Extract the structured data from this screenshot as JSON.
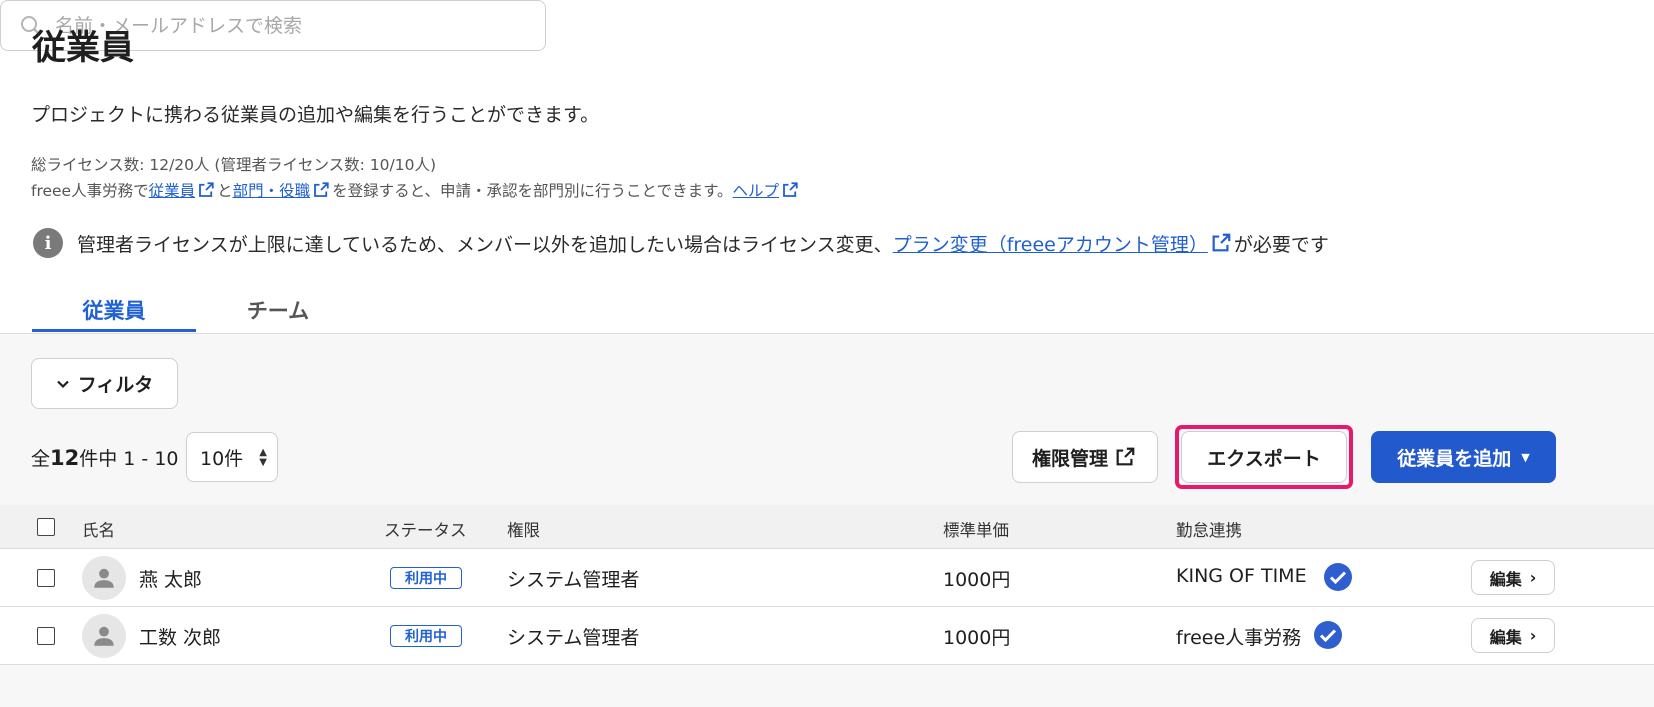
{
  "page": {
    "title": "従業員",
    "description": "プロジェクトに携わる従業員の追加や編集を行うことができます。",
    "license_info": "総ライセンス数: 12/20人 (管理者ライセンス数: 10/10人)",
    "register_prefix": "freee人事労務で",
    "register_link_employee": "従業員",
    "register_and": "と",
    "register_link_dept": "部門・役職",
    "register_suffix": "を登録すると、申請・承認を部門別に行うことできます。",
    "help_link": "ヘルプ"
  },
  "notice": {
    "text": "管理者ライセンスが上限に達しているため、メンバー以外を追加したい場合はライセンス変更、",
    "link": "プラン変更（freeeアカウント管理）",
    "suffix": "が必要です"
  },
  "tabs": [
    {
      "label": "従業員",
      "active": true
    },
    {
      "label": "チーム",
      "active": false
    }
  ],
  "toolbar": {
    "filter_label": "フィルタ",
    "search_placeholder": "名前・メールアドレスで検索",
    "count_prefix": "全",
    "count_total": "12",
    "count_suffix": "件中 1 - 10",
    "per_page": "10件",
    "permission_label": "権限管理",
    "export_label": "エクスポート",
    "add_label": "従業員を追加"
  },
  "table": {
    "headers": {
      "name": "氏名",
      "status": "ステータス",
      "role": "権限",
      "rate": "標準単価",
      "attendance": "勤怠連携"
    },
    "rows": [
      {
        "name": "燕 太郎",
        "status": "利用中",
        "role": "システム管理者",
        "rate": "1000円",
        "attendance": "KING OF TIME",
        "edit": "編集"
      },
      {
        "name": "工数 次郎",
        "status": "利用中",
        "role": "システム管理者",
        "rate": "1000円",
        "attendance": "freee人事労務",
        "edit": "編集"
      }
    ]
  },
  "colors": {
    "accent": "#2062d6",
    "primary_button": "#2259cc",
    "highlight_border": "#e8186a",
    "check": "#2f5fcf"
  }
}
